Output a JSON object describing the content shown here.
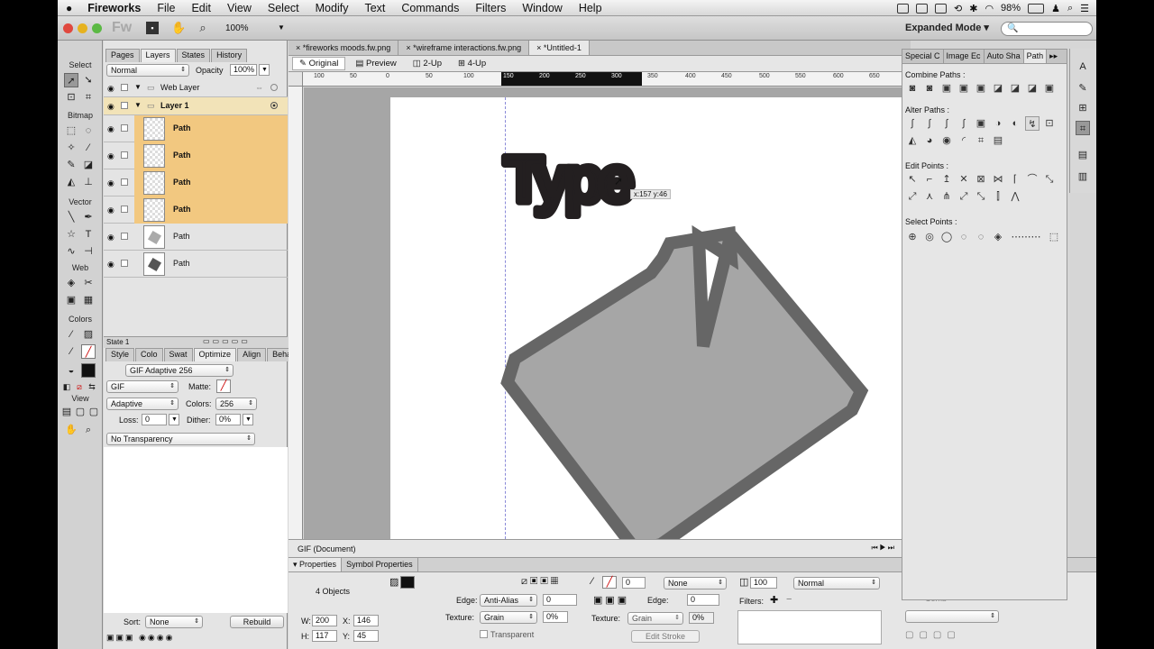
{
  "menubar": {
    "apple": "",
    "app": "Fireworks",
    "items": [
      "File",
      "Edit",
      "View",
      "Select",
      "Modify",
      "Text",
      "Commands",
      "Filters",
      "Window",
      "Help"
    ],
    "battery": "98%"
  },
  "apptoolbar": {
    "logo": "Fw",
    "zoom": "100%",
    "mode": "Expanded Mode",
    "mode_caret": "▾",
    "search_icon": "🔍"
  },
  "tools": {
    "sections": [
      "Select",
      "Bitmap",
      "Vector",
      "Web",
      "Colors",
      "View"
    ]
  },
  "layers_panel": {
    "tabs": [
      "Pages",
      "Layers",
      "States",
      "History"
    ],
    "blend": "Normal",
    "opacity_label": "Opacity",
    "opacity": "100%",
    "web_layer": "Web Layer",
    "layer1": "Layer 1",
    "rows": [
      "Path",
      "Path",
      "Path",
      "Path",
      "Path",
      "Path"
    ],
    "state": "State 1"
  },
  "optimize_panel": {
    "tabs": [
      "Style",
      "Colo",
      "Swat",
      "Optimize",
      "Align",
      "Beha"
    ],
    "preset": "GIF Adaptive 256",
    "format": "GIF",
    "matte_label": "Matte:",
    "palette": "Adaptive",
    "colors_label": "Colors:",
    "colors": "256",
    "loss_label": "Loss:",
    "loss": "0",
    "dither_label": "Dither:",
    "dither": "0%",
    "transparency": "No Transparency",
    "sort_label": "Sort:",
    "sort": "None",
    "rebuild": "Rebuild"
  },
  "document": {
    "tabs": [
      "*fireworks moods.fw.png",
      "*wireframe interactions.fw.png",
      "*Untitled-1"
    ],
    "views": [
      "Original",
      "Preview",
      "2-Up",
      "4-Up"
    ],
    "ruler_labels": [
      "100",
      "50",
      "0",
      "50",
      "100",
      "150",
      "200",
      "250",
      "300",
      "350",
      "400",
      "450",
      "500",
      "550",
      "600",
      "650"
    ],
    "canvas_text": "Type",
    "tooltip": "x:157 y:46",
    "status": "GIF (Document)"
  },
  "properties": {
    "tabs": [
      "Properties",
      "Symbol Properties"
    ],
    "objects": "4 Objects",
    "w_label": "W:",
    "w": "200",
    "x_label": "X:",
    "x": "146",
    "h_label": "H:",
    "h": "117",
    "y_label": "Y:",
    "y": "45",
    "edge_label": "Edge:",
    "edge": "Anti-Alias",
    "edge_val": "0",
    "texture_label": "Texture:",
    "texture": "Grain",
    "texture_pct": "0%",
    "transparent": "Transparent",
    "stroke_size": "0",
    "stroke_type": "None",
    "stroke_edge_label": "Edge:",
    "stroke_edge": "0",
    "stroke_texture_label": "Texture:",
    "stroke_texture": "Grain",
    "stroke_texture_pct": "0%",
    "edit_stroke": "Edit Stroke",
    "opacity": "100",
    "blend": "Normal",
    "filters_label": "Filters:",
    "comb": "Comb"
  },
  "path_panel": {
    "tabs": [
      "Special C",
      "Image Ec",
      "Auto Sha",
      "Path"
    ],
    "combine": "Combine Paths :",
    "alter": "Alter Paths :",
    "edit": "Edit Points :",
    "select": "Select Points :"
  },
  "colors": {
    "layer_highlight": "#f2c880",
    "shape_stroke": "#666666",
    "shape_fill": "#a6a6a6",
    "type_fill": "#231f20"
  }
}
